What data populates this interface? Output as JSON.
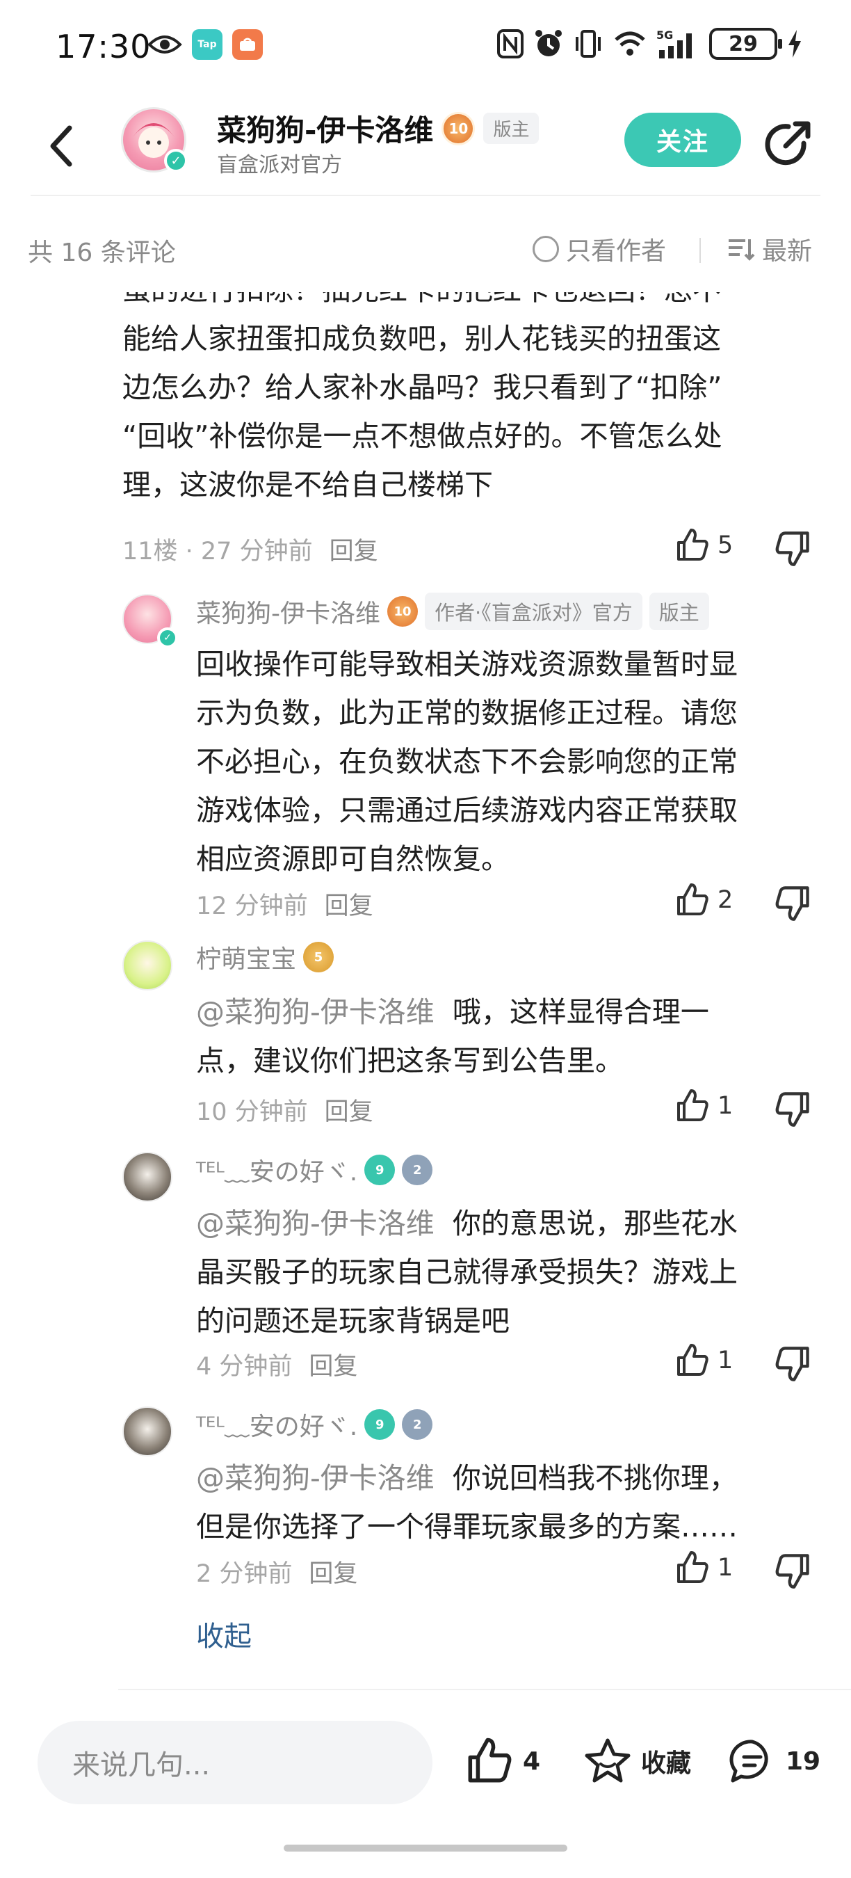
{
  "status_bar": {
    "time": "17:30",
    "battery": "29",
    "network": "5G",
    "app_badge_1": "Tap"
  },
  "header": {
    "name": "菜狗狗-伊卡洛维",
    "level": "10",
    "role": "版主",
    "subtitle": "盲盒派对官方",
    "follow_label": "关注"
  },
  "filter": {
    "count_text": "共 16 条评论",
    "author_only_label": "只看作者",
    "sort_label": "最新"
  },
  "main_comment": {
    "lines": [
      "蛋的进行扣除？抽完红卡的把红卡也退回？总不",
      "能给人家扭蛋扣成负数吧，别人花钱买的扭蛋这",
      "边怎么办？给人家补水晶吗？我只看到了“扣除”",
      "“回收”补偿你是一点不想做点好的。不管怎么处",
      "理，这波你是不给自己楼梯下"
    ],
    "floor_time": "11楼 · 27 分钟前",
    "reply_label": "回复",
    "likes": "5"
  },
  "replies": [
    {
      "name": "菜狗狗-伊卡洛维",
      "level": "10",
      "tag_author": "作者·《盲盒派对》官方",
      "tag_role": "版主",
      "mention": "",
      "lines": [
        "回收操作可能导致相关游戏资源数量暂时显",
        "示为负数，此为正常的数据修正过程。请您",
        "不必担心，在负数状态下不会影响您的正常",
        "游戏体验，只需通过后续游戏内容正常获取",
        "相应资源即可自然恢复。"
      ],
      "time": "12 分钟前",
      "reply_label": "回复",
      "likes": "2"
    },
    {
      "name": "柠萌宝宝",
      "level": "5",
      "mention": "@菜狗狗-伊卡洛维",
      "lines": [
        "哦，这样显得合理一",
        "点，建议你们把这条写到公告里。"
      ],
      "time": "10 分钟前",
      "reply_label": "回复",
      "likes": "1"
    },
    {
      "name": "ᵀᴱᴸ﹏安の好ヾ.",
      "level": "9",
      "level2": "2",
      "mention": "@菜狗狗-伊卡洛维",
      "lines": [
        "你的意思说，那些花水",
        "晶买骰子的玩家自己就得承受损失？游戏上",
        "的问题还是玩家背锅是吧"
      ],
      "time": "4 分钟前",
      "reply_label": "回复",
      "likes": "1"
    },
    {
      "name": "ᵀᴱᴸ﹏安の好ヾ.",
      "level": "9",
      "level2": "2",
      "mention": "@菜狗狗-伊卡洛维",
      "lines": [
        "你说回档我不挑你理，",
        "但是你选择了一个得罪玩家最多的方案……"
      ],
      "time": "2 分钟前",
      "reply_label": "回复",
      "likes": "1"
    }
  ],
  "collapse_label": "收起",
  "bottom_bar": {
    "input_placeholder": "来说几句...",
    "likes": "4",
    "favorite_label": "收藏",
    "comments": "19"
  },
  "colors": {
    "accent": "#3cc8b4",
    "collapse_link": "#2f5f8f",
    "muted": "#8a8a8a"
  }
}
